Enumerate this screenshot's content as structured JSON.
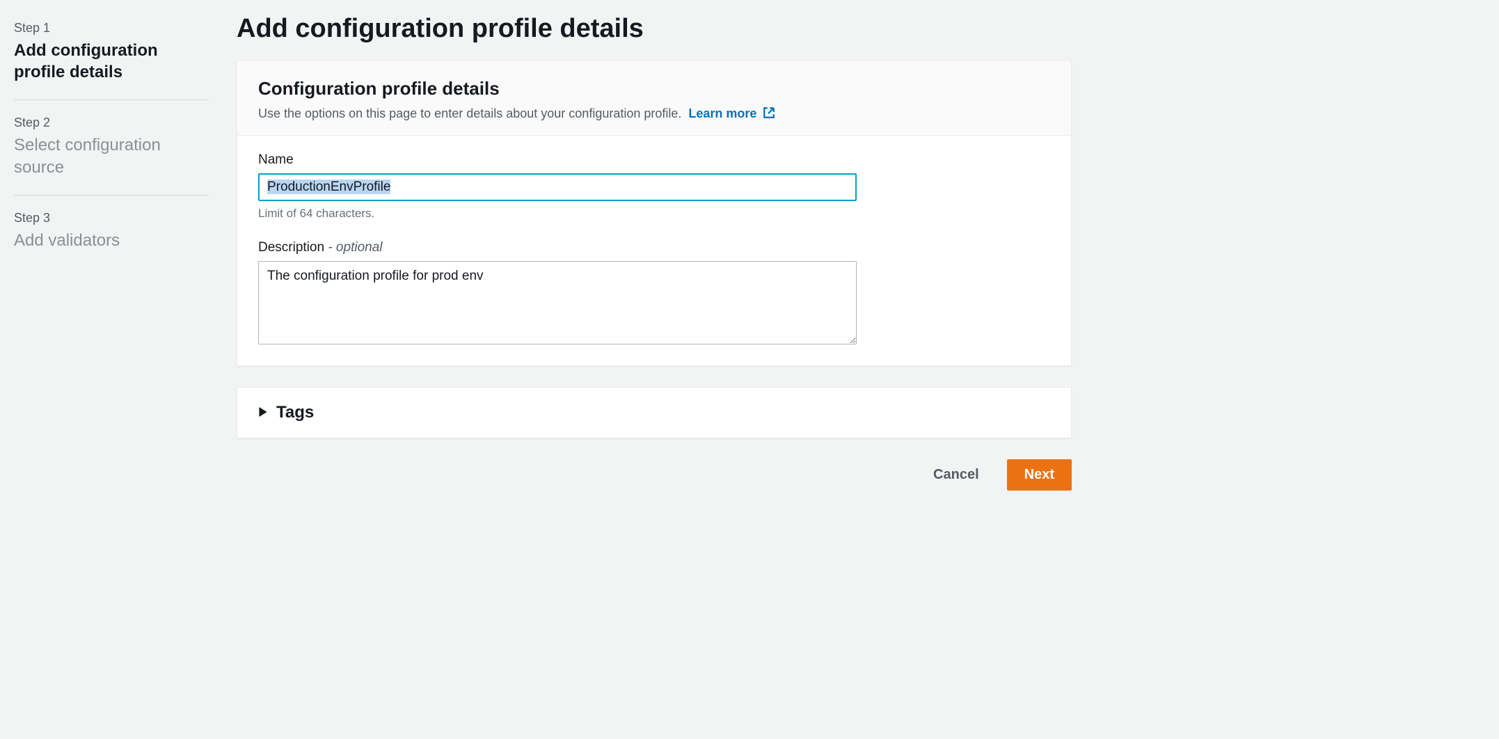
{
  "sidebar": {
    "steps": [
      {
        "num": "Step 1",
        "title": "Add configuration profile details",
        "active": true
      },
      {
        "num": "Step 2",
        "title": "Select configuration source",
        "active": false
      },
      {
        "num": "Step 3",
        "title": "Add validators",
        "active": false
      }
    ]
  },
  "page": {
    "title": "Add configuration profile details"
  },
  "panel": {
    "title": "Configuration profile details",
    "subtitle": "Use the options on this page to enter details about your configuration profile.",
    "learn_more": "Learn more"
  },
  "form": {
    "name_label": "Name",
    "name_value": "ProductionEnvProfile",
    "name_helper": "Limit of 64 characters.",
    "desc_label": "Description",
    "desc_optional": " - optional",
    "desc_value": "The configuration profile for prod env"
  },
  "tags": {
    "title": "Tags"
  },
  "footer": {
    "cancel": "Cancel",
    "next": "Next"
  }
}
